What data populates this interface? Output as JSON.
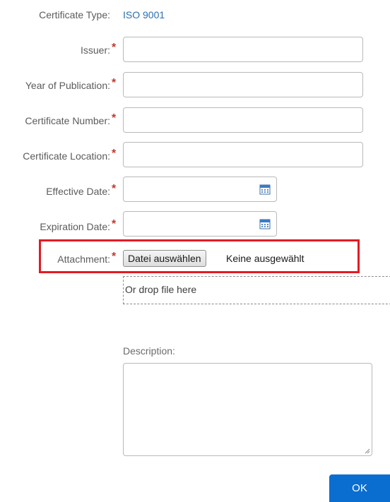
{
  "form": {
    "certificate_type_label": "Certificate Type:",
    "certificate_type_value": "ISO 9001",
    "fields": {
      "issuer": {
        "label": "Issuer:",
        "value": ""
      },
      "year_of_publication": {
        "label": "Year of Publication:",
        "value": ""
      },
      "certificate_number": {
        "label": "Certificate Number:",
        "value": ""
      },
      "certificate_location": {
        "label": "Certificate Location:",
        "value": ""
      },
      "effective_date": {
        "label": "Effective Date:",
        "value": ""
      },
      "expiration_date": {
        "label": "Expiration Date:",
        "value": ""
      }
    },
    "required_marker": "*",
    "attachment": {
      "label": "Attachment:",
      "button_label": "Datei auswählen",
      "status": "Keine ausgewählt",
      "drop_text": "Or drop file here"
    },
    "description": {
      "label": "Description:",
      "value": ""
    },
    "ok_label": "OK"
  },
  "icons": {
    "date_picker": "calendar-icon",
    "textarea_resize": "resize-grip-icon"
  },
  "colors": {
    "accent": "#0a6ed1",
    "link_value": "#2a6fb0",
    "required": "#c0392b",
    "highlight_box": "#e31b23"
  }
}
